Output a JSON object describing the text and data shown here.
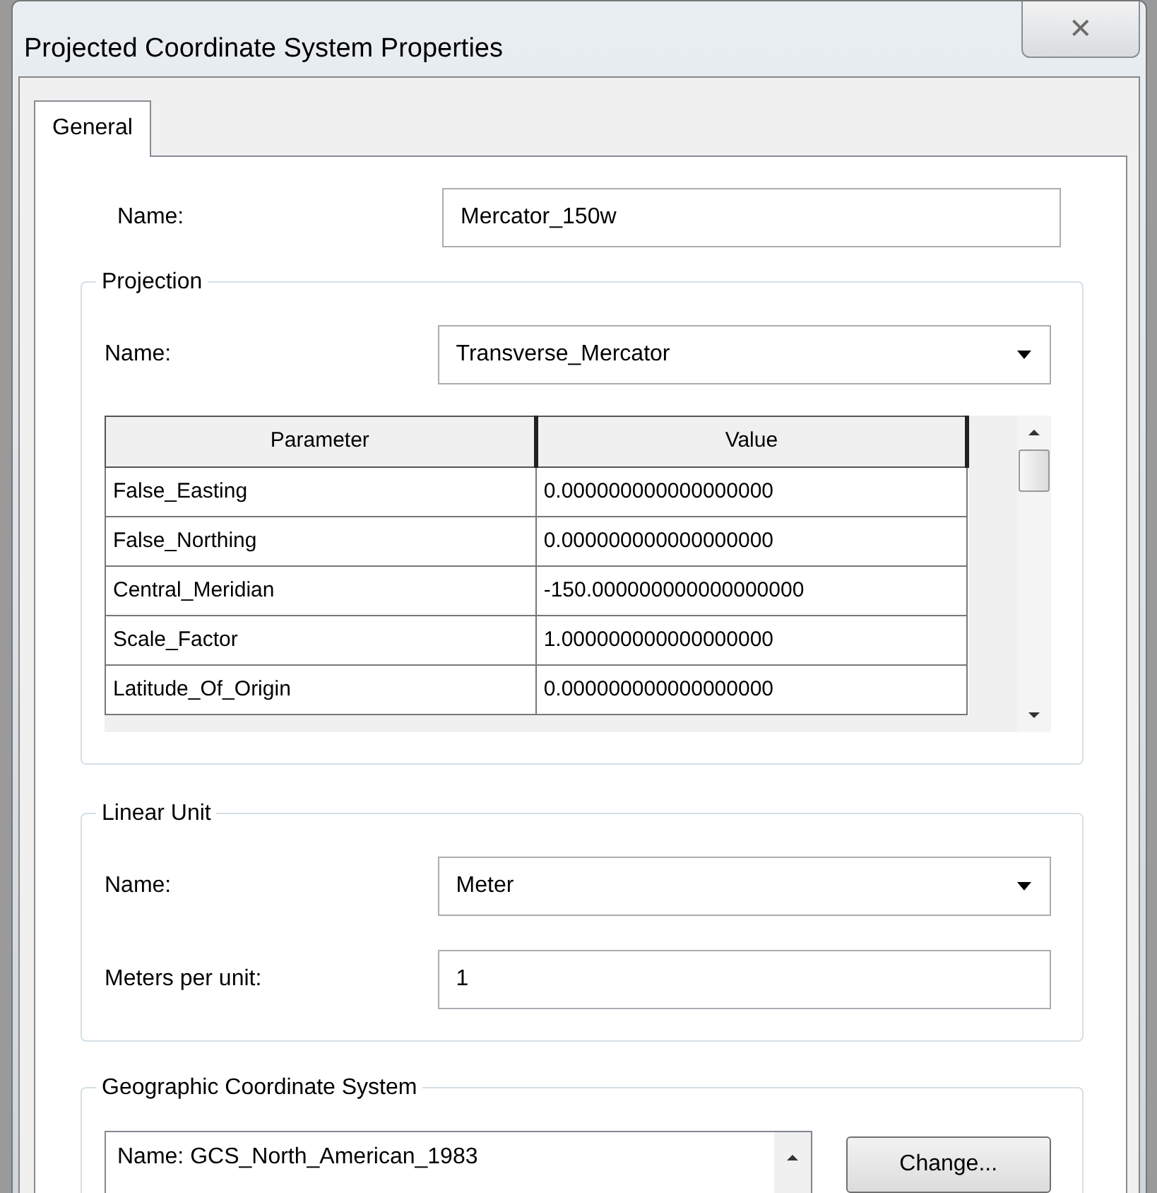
{
  "window": {
    "title": "Projected Coordinate System Properties",
    "close": "✕"
  },
  "tabs": [
    {
      "label": "General",
      "selected": true
    }
  ],
  "name_field": {
    "label": "Name:",
    "value": "Mercator_150w"
  },
  "projection": {
    "title": "Projection",
    "name_label": "Name:",
    "name_value": "Transverse_Mercator",
    "table": {
      "columns": [
        "Parameter",
        "Value"
      ],
      "rows": [
        [
          "False_Easting",
          "0.000000000000000000"
        ],
        [
          "False_Northing",
          "0.000000000000000000"
        ],
        [
          "Central_Meridian",
          "-150.000000000000000000"
        ],
        [
          "Scale_Factor",
          "1.000000000000000000"
        ],
        [
          "Latitude_Of_Origin",
          "0.000000000000000000"
        ]
      ]
    }
  },
  "linear_unit": {
    "title": "Linear Unit",
    "name_label": "Name:",
    "name_value": "Meter",
    "meters_label": "Meters per unit:",
    "meters_value": "1"
  },
  "gcs": {
    "title": "Geographic Coordinate System",
    "lines": [
      "Name: GCS_North_American_1983"
    ],
    "button": "Change..."
  }
}
